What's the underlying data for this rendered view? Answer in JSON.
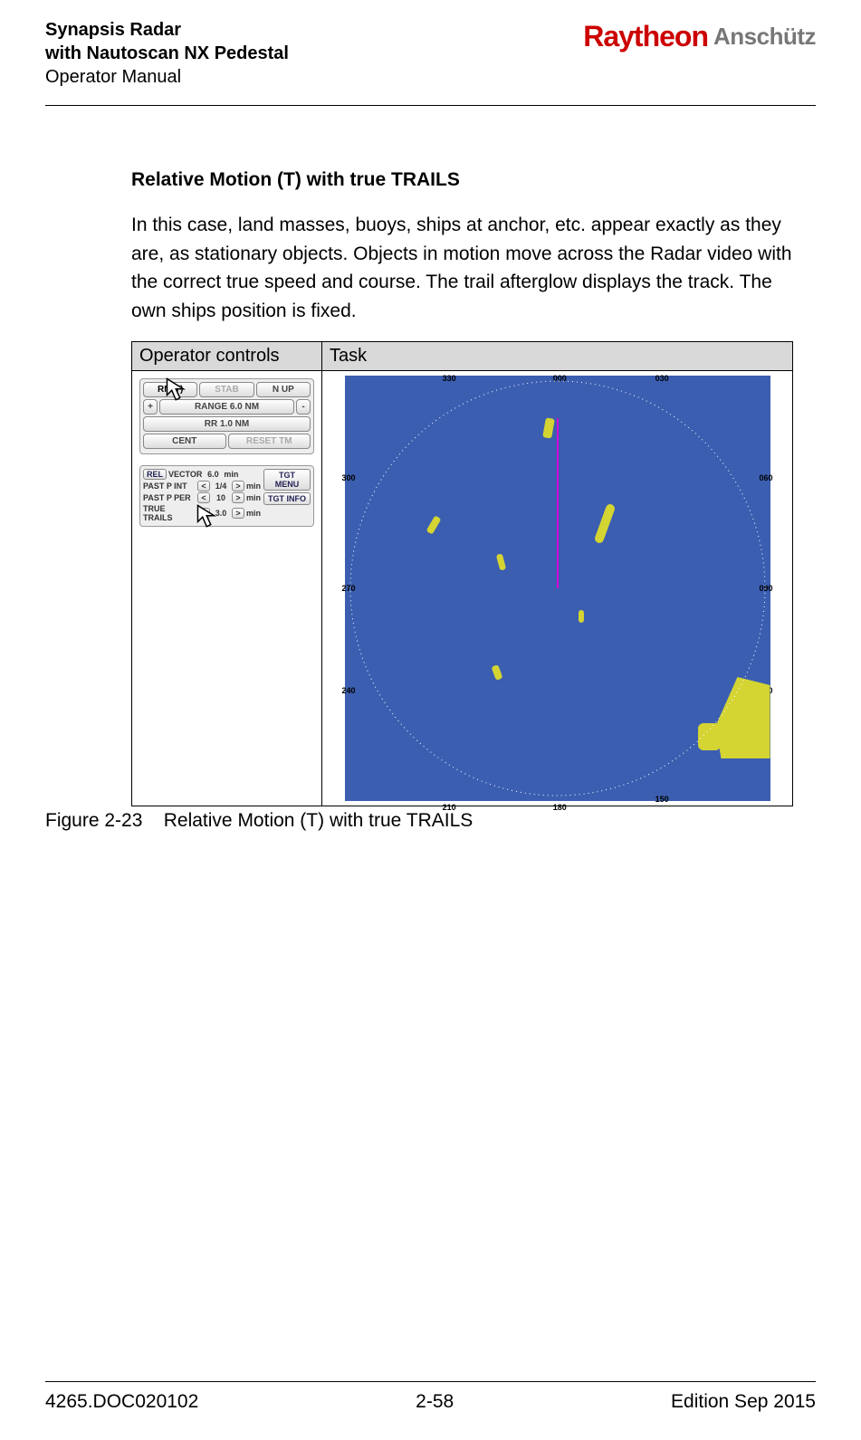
{
  "header": {
    "title_line1": "Synapsis Radar",
    "title_line2": "with Nautoscan NX Pedestal",
    "subtitle": "Operator Manual",
    "logo_brand1": "Raytheon",
    "logo_brand2": "Anschütz"
  },
  "section": {
    "title": "Relative Motion (T) with true TRAILS",
    "paragraph": "In this case, land masses, buoys, ships at anchor, etc. appear exactly as they are, as stationary objects. Objects in motion move across the Radar video with the correct true speed and course. The trail afterglow displays the track. The own ships position is fixed."
  },
  "table": {
    "col1": "Operator controls",
    "col2": "Task"
  },
  "panel1": {
    "rm": "RM(T)",
    "stab": "STAB",
    "nup": "N UP",
    "plus": "+",
    "range": "RANGE 6.0 NM",
    "minus": "-",
    "rr": "RR 1.0 NM",
    "cent": "CENT",
    "reset": "RESET TM"
  },
  "panel2": {
    "rel": "REL",
    "vector_lbl": "VECTOR",
    "vector_val": "6.0",
    "min": "min",
    "pastpint_lbl": "PAST P INT",
    "pastpint_val": "1/4",
    "pastpper_lbl": "PAST P PER",
    "pastpper_val": "10",
    "true_trails_lbl": "TRUE TRAILS",
    "true_trails_val": "3.0",
    "lt": "<",
    "gt": ">",
    "tgt_menu": "TGT MENU",
    "tgt_info": "TGT INFO"
  },
  "radar": {
    "bearings": {
      "b330": "330",
      "b000": "000",
      "b030": "030",
      "b060": "060",
      "b090": "090",
      "b120": "120",
      "b150": "150",
      "b180": "180",
      "b210": "210",
      "b240": "240",
      "b270": "270",
      "b300": "300"
    }
  },
  "figure": {
    "num": "Figure 2-23",
    "caption": "Relative Motion (T) with true TRAILS"
  },
  "footer": {
    "doc": "4265.DOC020102",
    "page": "2-58",
    "edition": "Edition Sep 2015"
  }
}
